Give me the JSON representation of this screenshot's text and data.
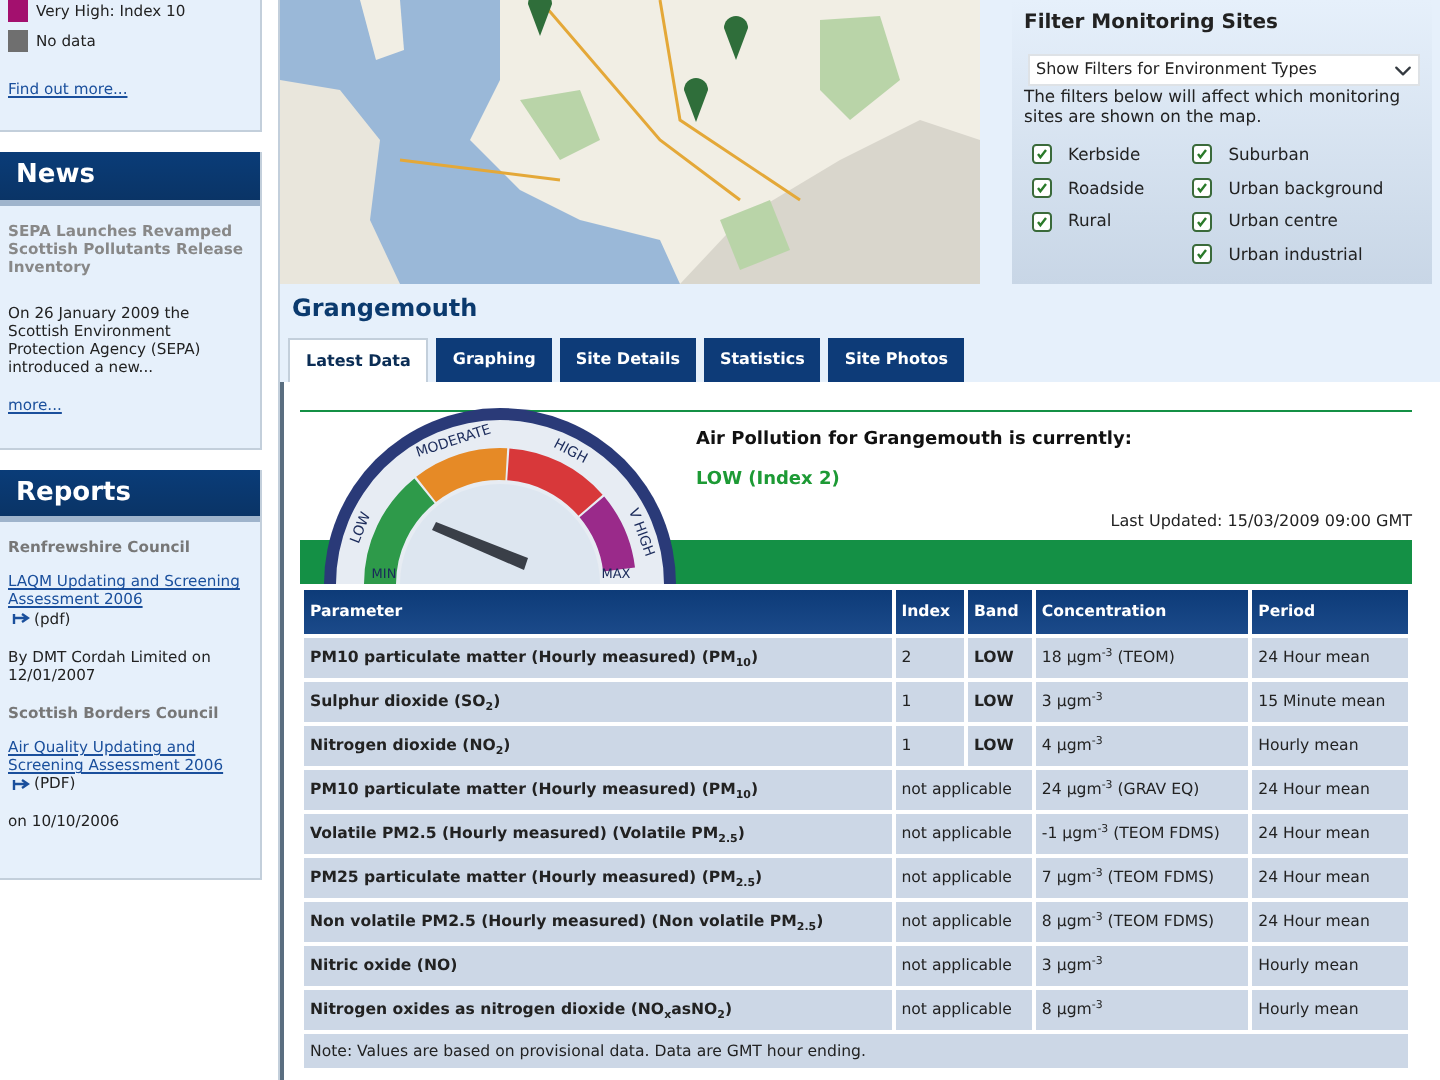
{
  "legend": [
    {
      "label": "Very High: Index 10",
      "color": "#a3106e"
    },
    {
      "label": "No data",
      "color": "#6f6f6f"
    }
  ],
  "legend_link": "Find out more...",
  "news": {
    "title": "News",
    "headline": "SEPA Launches Revamped Scottish Pollutants Release Inventory",
    "text": "On 26 January 2009 the Scottish Environment Protection Agency (SEPA) introduced a new...",
    "more": "more..."
  },
  "reports": {
    "title": "Reports",
    "items": [
      {
        "council": "Renfrewshire Council",
        "link": "LAQM Updating and Screening Assessment 2006",
        "format": "(pdf)",
        "byline": "By DMT Cordah Limited on 12/01/2007"
      },
      {
        "council": "Scottish Borders Council",
        "link": "Air Quality Updating and Screening Assessment 2006",
        "format": "(PDF)",
        "byline": "on 10/10/2006"
      }
    ]
  },
  "filter": {
    "title": "Filter Monitoring Sites",
    "select": "Show Filters for Environment Types",
    "note": "The filters below will affect which monitoring sites are shown on the map.",
    "columns": [
      [
        {
          "label": "Kerbside",
          "checked": true
        },
        {
          "label": "Roadside",
          "checked": true
        },
        {
          "label": "Rural",
          "checked": true
        }
      ],
      [
        {
          "label": "Suburban",
          "checked": true
        },
        {
          "label": "Urban background",
          "checked": true
        },
        {
          "label": "Urban centre",
          "checked": true
        },
        {
          "label": "Urban industrial",
          "checked": true
        }
      ]
    ]
  },
  "site": {
    "name": "Grangemouth"
  },
  "tabs": [
    {
      "label": "Latest Data",
      "selected": true
    },
    {
      "label": "Graphing",
      "selected": false
    },
    {
      "label": "Site Details",
      "selected": false
    },
    {
      "label": "Statistics",
      "selected": false
    },
    {
      "label": "Site Photos",
      "selected": false
    }
  ],
  "status": {
    "gauge": {
      "labels": [
        "LOW",
        "MODERATE",
        "HIGH",
        "V HIGH"
      ],
      "min": "MIN",
      "max": "MAX"
    },
    "heading": "Air Pollution for Grangemouth is currently:",
    "value": "LOW (Index 2)",
    "updated": "Last Updated: 15/03/2009 09:00 GMT"
  },
  "table": {
    "columns": [
      "Parameter",
      "Index",
      "Band",
      "Concentration",
      "Period"
    ],
    "rows": [
      {
        "parameter": "PM10 particulate matter (Hourly measured) (PM$_{10}$)",
        "index": "2",
        "band": "LOW",
        "concentration": "18 μgm$^{-3}$ (TEOM)",
        "period": "24 Hour mean"
      },
      {
        "parameter": "Sulphur dioxide (SO$_{2}$)",
        "index": "1",
        "band": "LOW",
        "concentration": "3 μgm$^{-3}$",
        "period": "15 Minute mean"
      },
      {
        "parameter": "Nitrogen dioxide (NO$_{2}$)",
        "index": "1",
        "band": "LOW",
        "concentration": "4 μgm$^{-3}$",
        "period": "Hourly mean"
      },
      {
        "parameter": "PM10 particulate matter (Hourly measured) (PM$_{10}$)",
        "index": "not applicable",
        "concentration": "24 μgm$^{-3}$ (GRAV EQ)",
        "period": "24 Hour mean"
      },
      {
        "parameter": "Volatile PM2.5 (Hourly measured) (Volatile PM$_{2.5}$)",
        "index": "not applicable",
        "concentration": "-1 μgm$^{-3}$ (TEOM FDMS)",
        "period": "24 Hour mean"
      },
      {
        "parameter": "PM25 particulate matter (Hourly measured) (PM$_{2.5}$)",
        "index": "not applicable",
        "concentration": "7 μgm$^{-3}$ (TEOM FDMS)",
        "period": "24 Hour mean"
      },
      {
        "parameter": "Non volatile PM2.5 (Hourly measured) (Non volatile PM$_{2.5}$)",
        "index": "not applicable",
        "concentration": "8 μgm$^{-3}$ (TEOM FDMS)",
        "period": "24 Hour mean"
      },
      {
        "parameter": "Nitric oxide (NO)",
        "index": "not applicable",
        "concentration": "3 μgm$^{-3}$",
        "period": "Hourly mean"
      },
      {
        "parameter": "Nitrogen oxides as nitrogen dioxide (NO$_{x}$asNO$_{2}$)",
        "index": "not applicable",
        "concentration": "8 μgm$^{-3}$",
        "period": "Hourly mean"
      }
    ],
    "note": "Note: Values are based on provisional data. Data are GMT hour ending."
  }
}
